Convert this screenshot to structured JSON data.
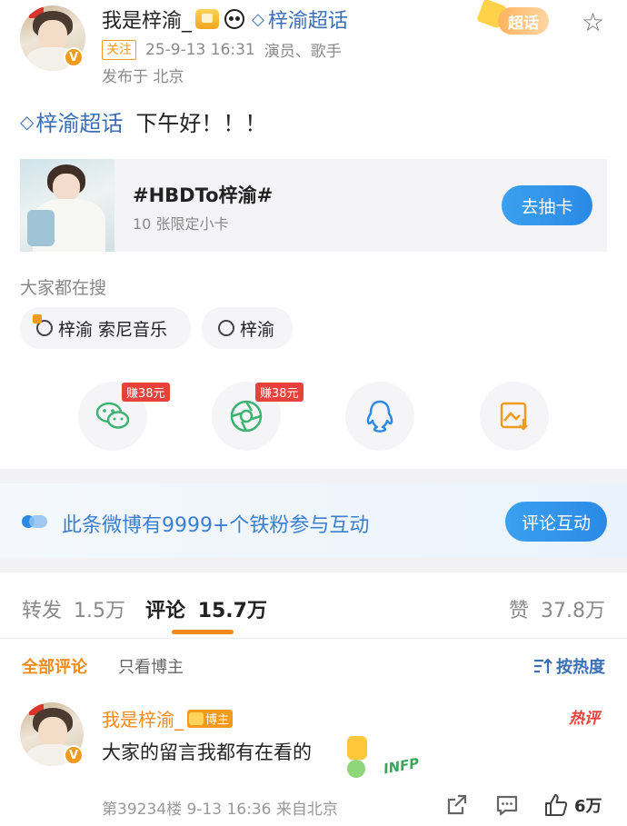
{
  "post": {
    "author_name": "我是梓渝_",
    "topic_name": "梓渝超话",
    "follow_label": "关注",
    "timestamp": "25-9-13 16:31",
    "author_title": "演员、歌手",
    "location": "发布于 北京",
    "chaohua_label": "超话",
    "body_topic": "梓渝超话",
    "body_text": "下午好！！！"
  },
  "promo_card": {
    "title": "#HBDTo梓渝#",
    "subtitle": "10 张限定小卡",
    "button_label": "去抽卡"
  },
  "search": {
    "heading": "大家都在搜",
    "chips": [
      {
        "label": "梓渝 索尼音乐",
        "icon": "hot-search-icon"
      },
      {
        "label": "梓渝",
        "icon": "search-icon"
      }
    ]
  },
  "share": {
    "items": [
      {
        "icon": "wechat-icon",
        "badge": "赚38元"
      },
      {
        "icon": "moments-icon",
        "badge": "赚38元"
      },
      {
        "icon": "qq-icon",
        "badge": ""
      },
      {
        "icon": "save-image-icon",
        "badge": ""
      }
    ]
  },
  "fans_banner": {
    "text": "此条微博有9999+个铁粉参与互动",
    "button_label": "评论互动"
  },
  "stats_tabs": {
    "repost_label": "转发",
    "repost_count": "1.5万",
    "comment_label": "评论",
    "comment_count": "15.7万",
    "like_label": "赞",
    "like_count": "37.8万"
  },
  "comment_filters": {
    "all_label": "全部评论",
    "owner_only_label": "只看博主",
    "sort_label": "按热度"
  },
  "comment": {
    "author_name": "我是梓渝_",
    "owner_tag": "博主",
    "hot_tag": "热评",
    "text": "大家的留言我都有在看的",
    "sticker_text": "INFP",
    "floor_info": "第39234楼 9-13 16:36 来自北京",
    "like_count": "6万"
  },
  "colors": {
    "accent_orange": "#f29a1c",
    "link_blue": "#3b6fb6",
    "button_blue": "#2a8ae6"
  }
}
